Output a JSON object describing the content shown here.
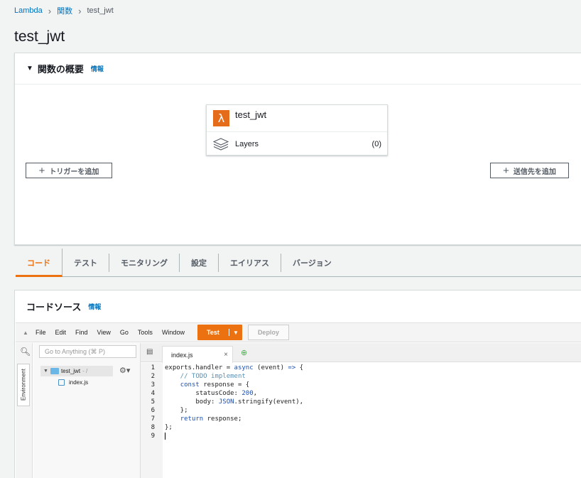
{
  "breadcrumb": {
    "lambda": "Lambda",
    "functions": "関数",
    "current": "test_jwt"
  },
  "page_title": "test_jwt",
  "overview": {
    "title": "関数の概要",
    "info": "情報",
    "function_name": "test_jwt",
    "layers_label": "Layers",
    "layers_count": "(0)",
    "add_trigger": "トリガーを追加",
    "add_destination": "送信先を追加"
  },
  "tabs": [
    {
      "label": "コード",
      "active": true
    },
    {
      "label": "テスト"
    },
    {
      "label": "モニタリング"
    },
    {
      "label": "設定"
    },
    {
      "label": "エイリアス"
    },
    {
      "label": "バージョン"
    }
  ],
  "code_source": {
    "title": "コードソース",
    "info": "情報"
  },
  "ide": {
    "menu": [
      "File",
      "Edit",
      "Find",
      "View",
      "Go",
      "Tools",
      "Window"
    ],
    "test_label": "Test",
    "deploy_label": "Deploy",
    "goto_placeholder": "Go to Anything (⌘ P)",
    "environment_label": "Environment",
    "folder_name": "test_jwt",
    "folder_suffix": "- /",
    "file_name": "index.js",
    "tab_name": "index.js"
  },
  "code_lines": [
    "exports.handler = async (event) => {",
    "    // TODO implement",
    "    const response = {",
    "        statusCode: 200,",
    "        body: JSON.stringify(event),",
    "    };",
    "    return response;",
    "};",
    ""
  ],
  "line_numbers": [
    "1",
    "2",
    "3",
    "4",
    "5",
    "6",
    "7",
    "8",
    "9"
  ],
  "colors": {
    "accent": "#ec7211",
    "link": "#0073bb",
    "lambda_icon": "#e46c1a"
  }
}
